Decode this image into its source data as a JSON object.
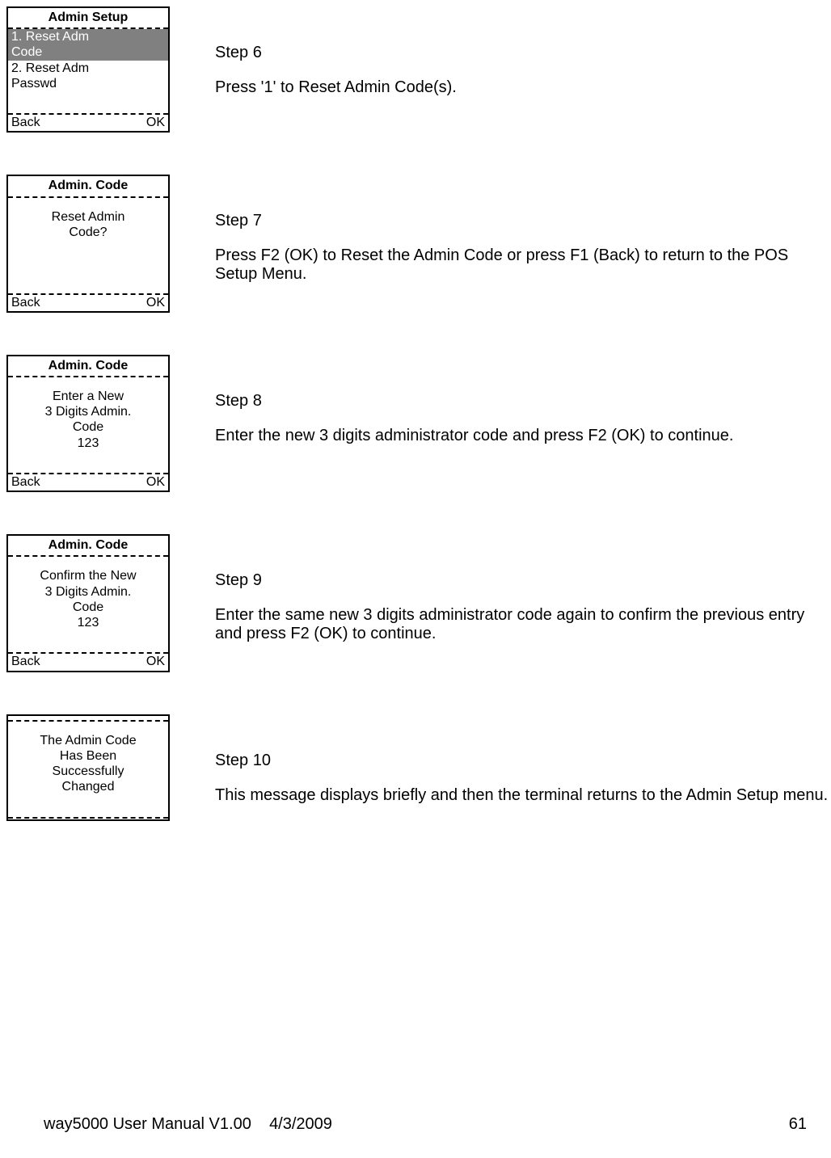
{
  "steps": [
    {
      "screen": {
        "title": "Admin Setup",
        "menu": [
          {
            "label": "1. Reset Adm\nCode",
            "selected": true
          },
          {
            "label": "2. Reset Adm\nPasswd",
            "selected": false
          }
        ],
        "soft_left": "Back",
        "soft_right": "OK"
      },
      "step_label": "Step 6",
      "body": "Press '1' to Reset Admin Code(s)."
    },
    {
      "screen": {
        "title": "Admin. Code",
        "lines": [
          "Reset Admin",
          "Code?"
        ],
        "soft_left": "Back",
        "soft_right": "OK"
      },
      "step_label": "Step 7",
      "body": "Press F2 (OK) to Reset the Admin Code or press F1 (Back) to return to the POS Setup Menu."
    },
    {
      "screen": {
        "title": "Admin. Code",
        "lines": [
          "Enter a New",
          "3 Digits Admin.",
          "Code",
          "123"
        ],
        "soft_left": "Back",
        "soft_right": "OK"
      },
      "step_label": "Step 8",
      "body": "Enter the new 3 digits administrator code and press F2 (OK) to continue."
    },
    {
      "screen": {
        "title": "Admin. Code",
        "lines": [
          "Confirm the New",
          "3 Digits Admin.",
          "Code",
          "123"
        ],
        "soft_left": "Back",
        "soft_right": "OK"
      },
      "step_label": "Step 9",
      "body": "Enter the same new 3 digits administrator code again to confirm the previous entry and press F2 (OK) to continue."
    },
    {
      "screen": {
        "title": " ",
        "lines": [
          "The Admin Code",
          "Has Been",
          "Successfully",
          "Changed"
        ],
        "soft_left": " ",
        "soft_right": " "
      },
      "step_label": "Step 10",
      "body": "This message displays briefly and then the terminal returns to the Admin Setup menu."
    }
  ],
  "footer": {
    "left": "way5000 User Manual V1.00",
    "center": "4/3/2009",
    "right": "61"
  }
}
